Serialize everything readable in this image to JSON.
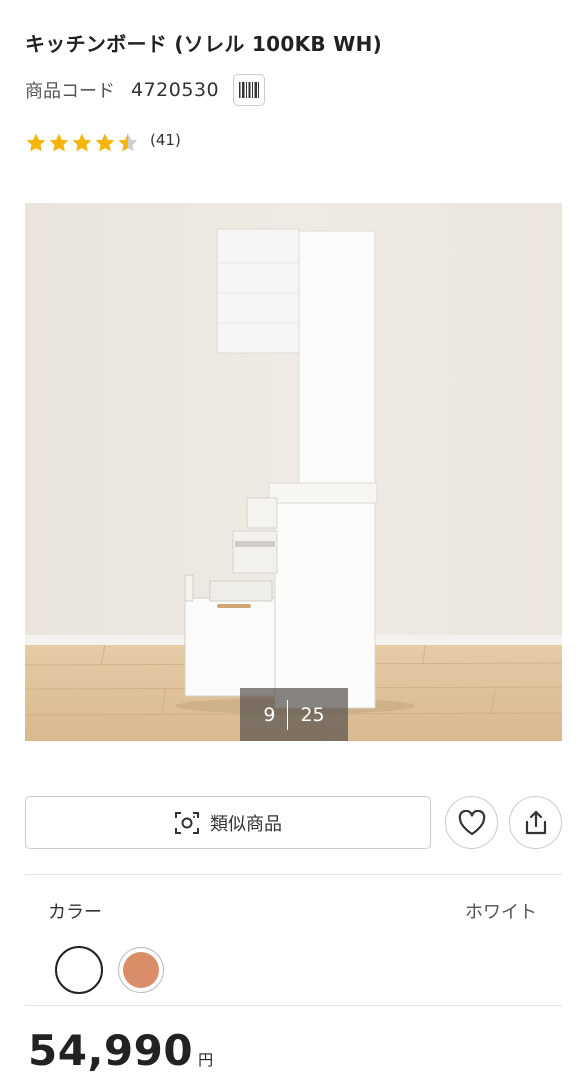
{
  "product": {
    "title": "キッチンボード (ソレル 100KB WH)",
    "code_label": "商品コード",
    "code_value": "4720530",
    "rating": 4.5,
    "review_count": "(41)"
  },
  "image": {
    "current_index": "9",
    "total": "25"
  },
  "actions": {
    "similar_label": "類似商品",
    "favorite_icon": "heart-icon",
    "share_icon": "share-icon",
    "barcode_icon": "barcode-icon",
    "similar_icon": "camera-scan-icon"
  },
  "color": {
    "label": "カラー",
    "selected_value": "ホワイト",
    "swatches": [
      {
        "name": "white",
        "hex": "#ffffff",
        "selected": true
      },
      {
        "name": "orange",
        "hex": "#d98d68",
        "selected": false
      }
    ]
  },
  "price": {
    "amount": "54,990",
    "currency": "円"
  },
  "colors": {
    "star": "#f5b50b",
    "star_empty": "#cfcfcf",
    "text": "#222222",
    "border": "#cccccc"
  }
}
